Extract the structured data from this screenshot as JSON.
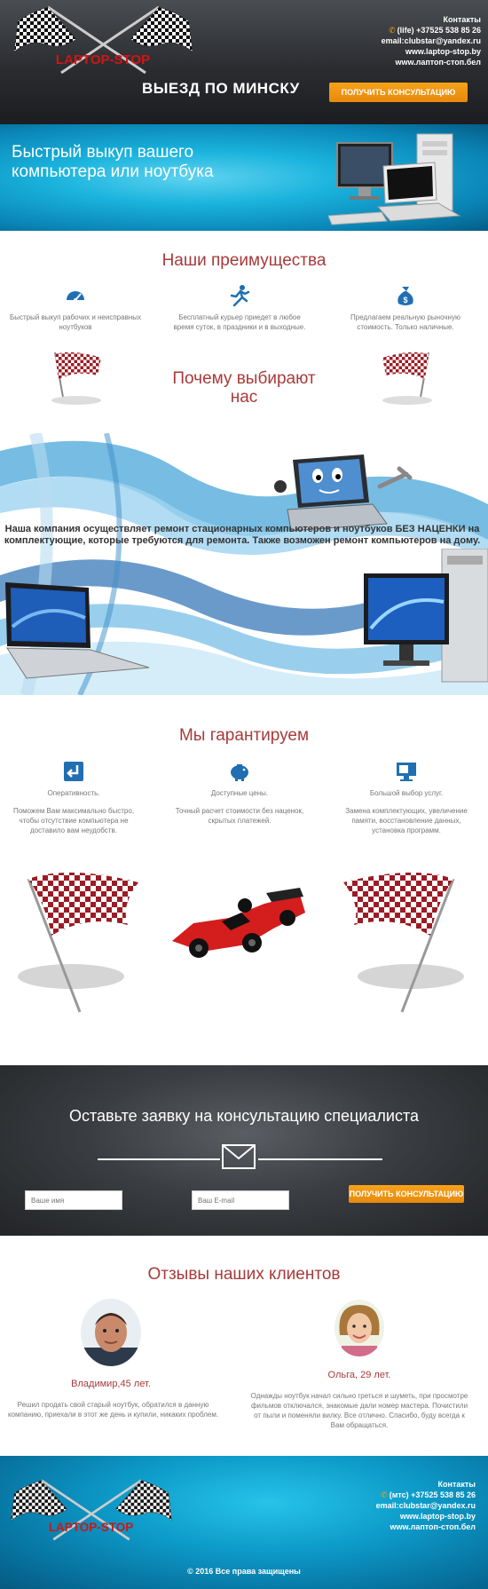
{
  "header": {
    "logo_text": "LAPTOP-STOP",
    "contacts": {
      "title": "Контакты",
      "phone": "(life) +37525 538 85 26",
      "email": "email:clubstar@yandex.ru",
      "site1": "www.laptop-stop.by",
      "site2": "www.лаптоп-стоп.бел"
    },
    "title": "ВЫЕЗД ПО МИНСКУ",
    "button_label": "ПОЛУЧИТЬ КОНСУЛЬТАЦИЮ"
  },
  "banner": {
    "title": "Быстрый выкуп вашего компьютера или ноутбука"
  },
  "advantages": {
    "title": "Наши преимущества",
    "items": [
      {
        "icon": "speedometer-icon",
        "text": "Быстрый выкуп рабочих и неисправных ноутбуков"
      },
      {
        "icon": "runner-icon",
        "text": "Бесплатный курьер приедет в любое время суток, в праздники и в выходные."
      },
      {
        "icon": "money-bag-icon",
        "text": "Предлагаем реальную рыночную стоимость. Только наличные."
      }
    ]
  },
  "why": {
    "title": "Почему выбирают нас",
    "text": "Наша компания осуществляет ремонт стационарных компьютеров и ноутбуков БЕЗ НАЦЕНКИ на комплектующие, которые требуются для ремонта. Также возможен ремонт компьютеров на дому."
  },
  "guarantee": {
    "title": "Мы гарантируем",
    "items": [
      {
        "icon": "return-arrow-icon",
        "heading": "Оперативность.",
        "text": "Поможем Вам максимально быстро, чтобы отсутствие компьютера не доставило вам неудобств."
      },
      {
        "icon": "piggy-bank-icon",
        "heading": "Доступные цены.",
        "text": "Точный расчет стоимости без наценок, скрытых платежей."
      },
      {
        "icon": "monitor-icon",
        "heading": "Большой выбор услуг.",
        "text": "Замена комплектующих, увеличение памяти, восстановление данных, установка программ."
      }
    ]
  },
  "form": {
    "title": "Оставьте заявку на консультацию специалиста",
    "name_placeholder": "Ваше имя",
    "email_placeholder": "Ваш E-mail",
    "button_label": "ПОЛУЧИТЬ КОНСУЛЬТАЦИЮ"
  },
  "reviews": {
    "title": "Отзывы наших клиентов",
    "items": [
      {
        "name": "Владимир,45 лет.",
        "text": "Решил продать свой старый ноутбук, обратился в данную компанию, приехали в этот же день и купили, никаких проблем."
      },
      {
        "name": "Ольга, 29 лет.",
        "text": "Однажды ноутбук начал сильно греться и шуметь, при просмотре фильмов отключался, знакомые дали номер мастера. Почистили от пыли и поменяли вилку. Все отлично. Спасибо, буду всегда к Вам обращаться."
      }
    ]
  },
  "footer": {
    "logo_text": "LAPTOP-STOP",
    "contacts": {
      "title": "Контакты",
      "phone": "(мтс) +37525 538 85 26",
      "email": "email:clubstar@yandex.ru",
      "site1": "www.laptop-stop.by",
      "site2": "www.лаптоп-стоп.бел"
    },
    "copyright": "© 2016 Все права защищены"
  },
  "colors": {
    "accent_orange": "#f39c12",
    "title_red": "#a83a3a",
    "icon_blue": "#1f6fb2"
  }
}
